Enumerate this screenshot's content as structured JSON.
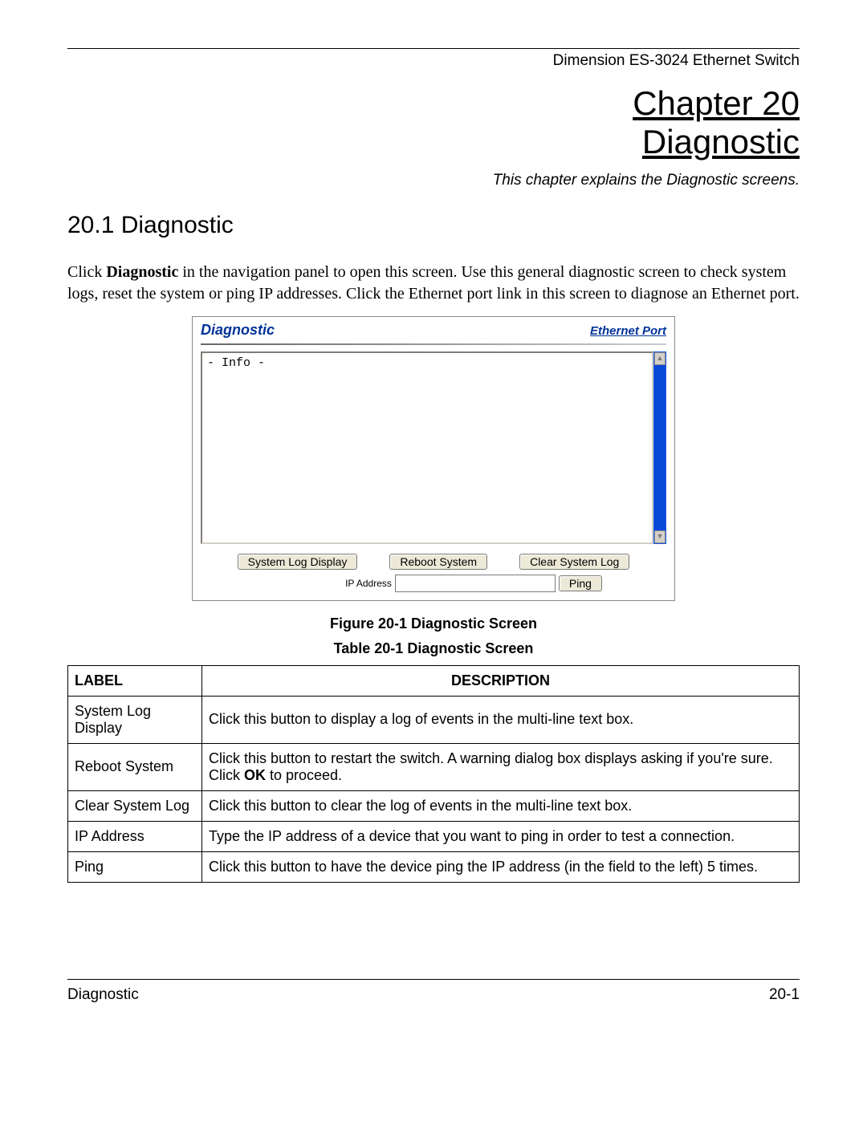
{
  "header": {
    "product": "Dimension ES-3024 Ethernet Switch"
  },
  "chapter": {
    "title_line1": "Chapter 20",
    "title_line2": "Diagnostic",
    "subtitle": "This chapter explains the Diagnostic screens."
  },
  "section": {
    "heading": "20.1 Diagnostic",
    "para_pre": "Click ",
    "para_bold": "Diagnostic",
    "para_post": " in the navigation panel to open this screen. Use this general diagnostic screen to check system logs, reset the system or ping IP addresses. Click the Ethernet port link in this screen to diagnose an Ethernet port."
  },
  "screenshot": {
    "panel_title": "Diagnostic",
    "panel_link": "Ethernet Port",
    "textarea_content": "- Info -",
    "buttons": {
      "syslog": "System Log Display",
      "reboot": "Reboot System",
      "clear": "Clear System Log",
      "ping": "Ping"
    },
    "ip_label": "IP Address",
    "ip_value": ""
  },
  "figure_caption": "Figure 20-1 Diagnostic Screen",
  "table_caption": "Table 20-1 Diagnostic Screen",
  "table": {
    "head_label": "LABEL",
    "head_desc": "DESCRIPTION",
    "rows": [
      {
        "label": "System Log Display",
        "desc_pre": "Click this button to display a log of events in the multi-line text box.",
        "desc_bold": "",
        "desc_post": ""
      },
      {
        "label": "Reboot System",
        "desc_pre": "Click this button to restart the switch. A warning dialog box displays asking if you're sure. Click ",
        "desc_bold": "OK",
        "desc_post": " to proceed."
      },
      {
        "label": "Clear System Log",
        "desc_pre": "Click this button to clear the log of events in the multi-line text box.",
        "desc_bold": "",
        "desc_post": ""
      },
      {
        "label": "IP Address",
        "desc_pre": "Type the IP address of a device that you want to ping in order to test a connection.",
        "desc_bold": "",
        "desc_post": ""
      },
      {
        "label": "Ping",
        "desc_pre": "Click this button to have the device ping the IP address (in the field to the left) 5 times.",
        "desc_bold": "",
        "desc_post": ""
      }
    ]
  },
  "footer": {
    "left": "Diagnostic",
    "right": "20-1"
  }
}
